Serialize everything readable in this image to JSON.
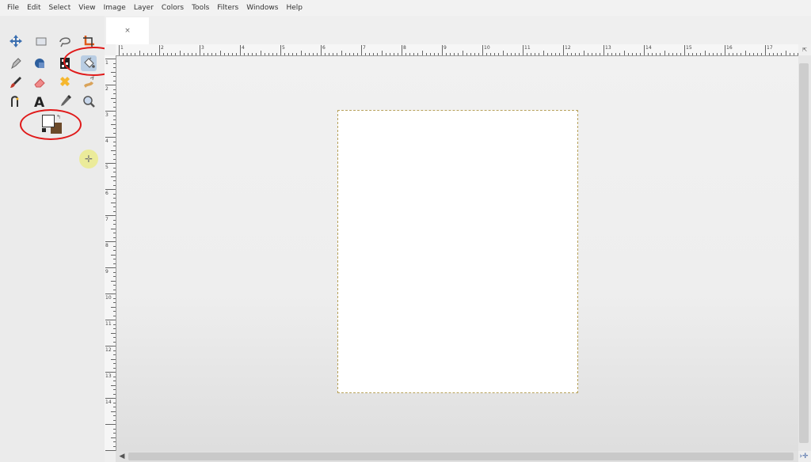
{
  "menu": [
    {
      "label": "File"
    },
    {
      "label": "Edit"
    },
    {
      "label": "Select"
    },
    {
      "label": "View"
    },
    {
      "label": "Image"
    },
    {
      "label": "Layer"
    },
    {
      "label": "Colors"
    },
    {
      "label": "Tools"
    },
    {
      "label": "Filters"
    },
    {
      "label": "Windows"
    },
    {
      "label": "Help"
    }
  ],
  "image_tab": {
    "close_glyph": "×"
  },
  "toolbox": {
    "tools": [
      {
        "name": "move-tool-icon"
      },
      {
        "name": "rect-select-tool-icon"
      },
      {
        "name": "free-select-tool-icon"
      },
      {
        "name": "crop-tool-icon"
      },
      {
        "name": "pen-tool-icon"
      },
      {
        "name": "clone-tool-icon"
      },
      {
        "name": "perspective-tool-icon"
      },
      {
        "name": "bucket-fill-tool-icon",
        "active": true
      },
      {
        "name": "paintbrush-tool-icon"
      },
      {
        "name": "eraser-tool-icon"
      },
      {
        "name": "heal-tool-icon"
      },
      {
        "name": "smudge-tool-icon"
      },
      {
        "name": "paths-tool-icon"
      },
      {
        "name": "text-tool-icon"
      },
      {
        "name": "color-picker-tool-icon"
      },
      {
        "name": "zoom-tool-icon"
      }
    ],
    "fg_color": "#ffffff",
    "bg_color": "#6b4a2a"
  },
  "ruler_top_labels": [
    "1",
    "2",
    "3",
    "4",
    "5",
    "6",
    "7",
    "8",
    "9",
    "10",
    "11",
    "12",
    "13",
    "14",
    "15",
    "16",
    "17"
  ],
  "ruler_left_labels": [
    "1",
    "2",
    "3",
    "4",
    "5",
    "6",
    "7",
    "8",
    "9",
    "10",
    "11",
    "12",
    "13",
    "14"
  ],
  "colors": {
    "highlight": "#e01919",
    "selection": "#b7a15a",
    "active_tool": "#b9cde3"
  }
}
